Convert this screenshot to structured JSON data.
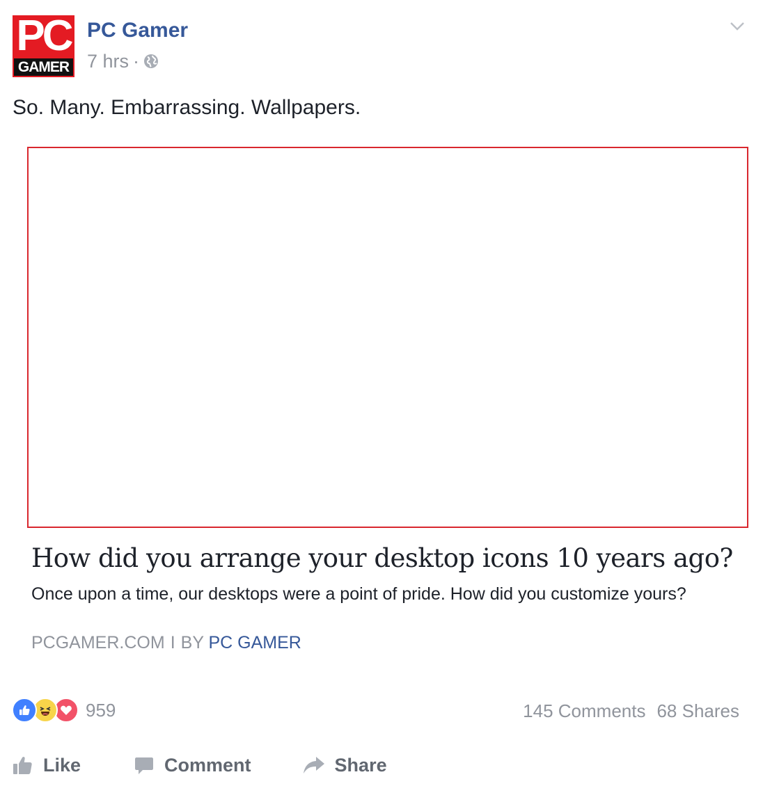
{
  "post": {
    "page_name": "PC Gamer",
    "timestamp": "7 hrs",
    "separator": "·",
    "text": "So. Many. Embarrassing. Wallpapers.",
    "avatar": {
      "top_text": "PC",
      "bottom_text": "GAMER",
      "brand_color": "#e41b23"
    }
  },
  "link": {
    "title": "How did you arrange your desktop icons 10 years ago?",
    "description": "Once upon a time, our desktops were a point of pride. How did you customize yours?",
    "domain": "PCGAMER.COM",
    "separator": "I",
    "by_prefix": "BY",
    "by_name": "PC GAMER"
  },
  "engagement": {
    "reactions": [
      "like-icon",
      "haha-icon",
      "love-icon"
    ],
    "reaction_count": "959",
    "comments": "145 Comments",
    "shares": "68 Shares"
  },
  "actions": {
    "like_label": "Like",
    "comment_label": "Comment",
    "share_label": "Share"
  },
  "colors": {
    "link_blue": "#365899",
    "meta_gray": "#90949c",
    "text": "#1d2129",
    "action_gray": "#616770",
    "image_border": "#d9272e"
  }
}
